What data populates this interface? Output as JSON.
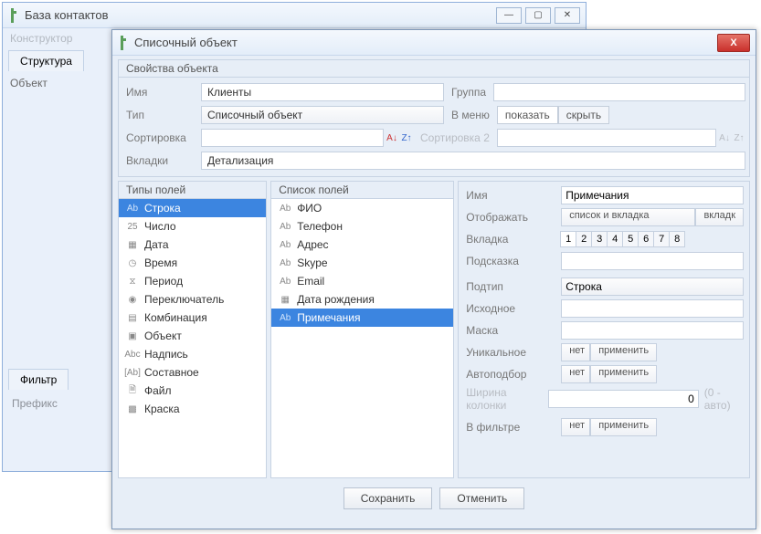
{
  "bg": {
    "title": "База контактов",
    "winbtns": {
      "min": "—",
      "max": "▢",
      "close": "✕"
    },
    "menu": "Конструктор",
    "tabs": [
      "Структура"
    ],
    "row_label": "Объект",
    "filter_tab": "Фильтр",
    "prefix_label": "Префикс"
  },
  "dlg": {
    "title": "Списочный объект",
    "close": "X",
    "props_title": "Свойства объекта",
    "labels": {
      "name": "Имя",
      "group": "Группа",
      "type": "Тип",
      "inmenu": "В меню",
      "sort": "Сортировка",
      "sort2": "Сортировка 2",
      "tabs": "Вкладки"
    },
    "values": {
      "name": "Клиенты",
      "group": "",
      "type": "Списочный объект",
      "inmenu_show": "показать",
      "inmenu_hide": "скрыть",
      "sort1": "",
      "sort2": "",
      "tabs": "Детализация"
    },
    "types_title": "Типы полей",
    "types": [
      {
        "ic": "str",
        "label": "Строка",
        "sel": true
      },
      {
        "ic": "num",
        "label": "Число"
      },
      {
        "ic": "date",
        "label": "Дата"
      },
      {
        "ic": "time",
        "label": "Время"
      },
      {
        "ic": "period",
        "label": "Период"
      },
      {
        "ic": "switch",
        "label": "Переключатель"
      },
      {
        "ic": "combo",
        "label": "Комбинация"
      },
      {
        "ic": "obj",
        "label": "Объект"
      },
      {
        "ic": "label",
        "label": "Надпись"
      },
      {
        "ic": "compound",
        "label": "Составное"
      },
      {
        "ic": "file",
        "label": "Файл"
      },
      {
        "ic": "color",
        "label": "Краска"
      }
    ],
    "fields_title": "Список полей",
    "fields": [
      {
        "label": "ФИО"
      },
      {
        "label": "Телефон"
      },
      {
        "label": "Адрес"
      },
      {
        "label": "Skype"
      },
      {
        "label": "Email"
      },
      {
        "label": "Дата рождения",
        "ic": "date"
      },
      {
        "label": "Примечания",
        "sel": true
      }
    ],
    "right": {
      "name_l": "Имя",
      "name_v": "Примечания",
      "display_l": "Отображать",
      "display_v": "список и вкладка",
      "display_b": "вкладк",
      "tab_l": "Вкладка",
      "tab_nums": [
        "1",
        "2",
        "3",
        "4",
        "5",
        "6",
        "7",
        "8"
      ],
      "tab_active": 0,
      "hint_l": "Подсказка",
      "hint_v": "",
      "subtype_l": "Подтип",
      "subtype_v": "Строка",
      "default_l": "Исходное",
      "default_v": "",
      "mask_l": "Маска",
      "mask_v": "",
      "unique_l": "Уникальное",
      "unique_v": "нет",
      "apply": "применить",
      "auto_l": "Автоподбор",
      "auto_v": "нет",
      "colw_l": "Ширина колонки",
      "colw_v": "0",
      "colw_hint": "(0 - авто)",
      "filter_l": "В фильтре",
      "filter_v": "нет"
    },
    "save": "Сохранить",
    "cancel": "Отменить"
  },
  "icons": {
    "str": "Ab",
    "num": "25",
    "date": "▦",
    "time": "◷",
    "period": "⧖",
    "switch": "◉",
    "combo": "▤",
    "obj": "▣",
    "label": "Abc",
    "compound": "[Ab]",
    "file": "🗎",
    "color": "▩"
  }
}
